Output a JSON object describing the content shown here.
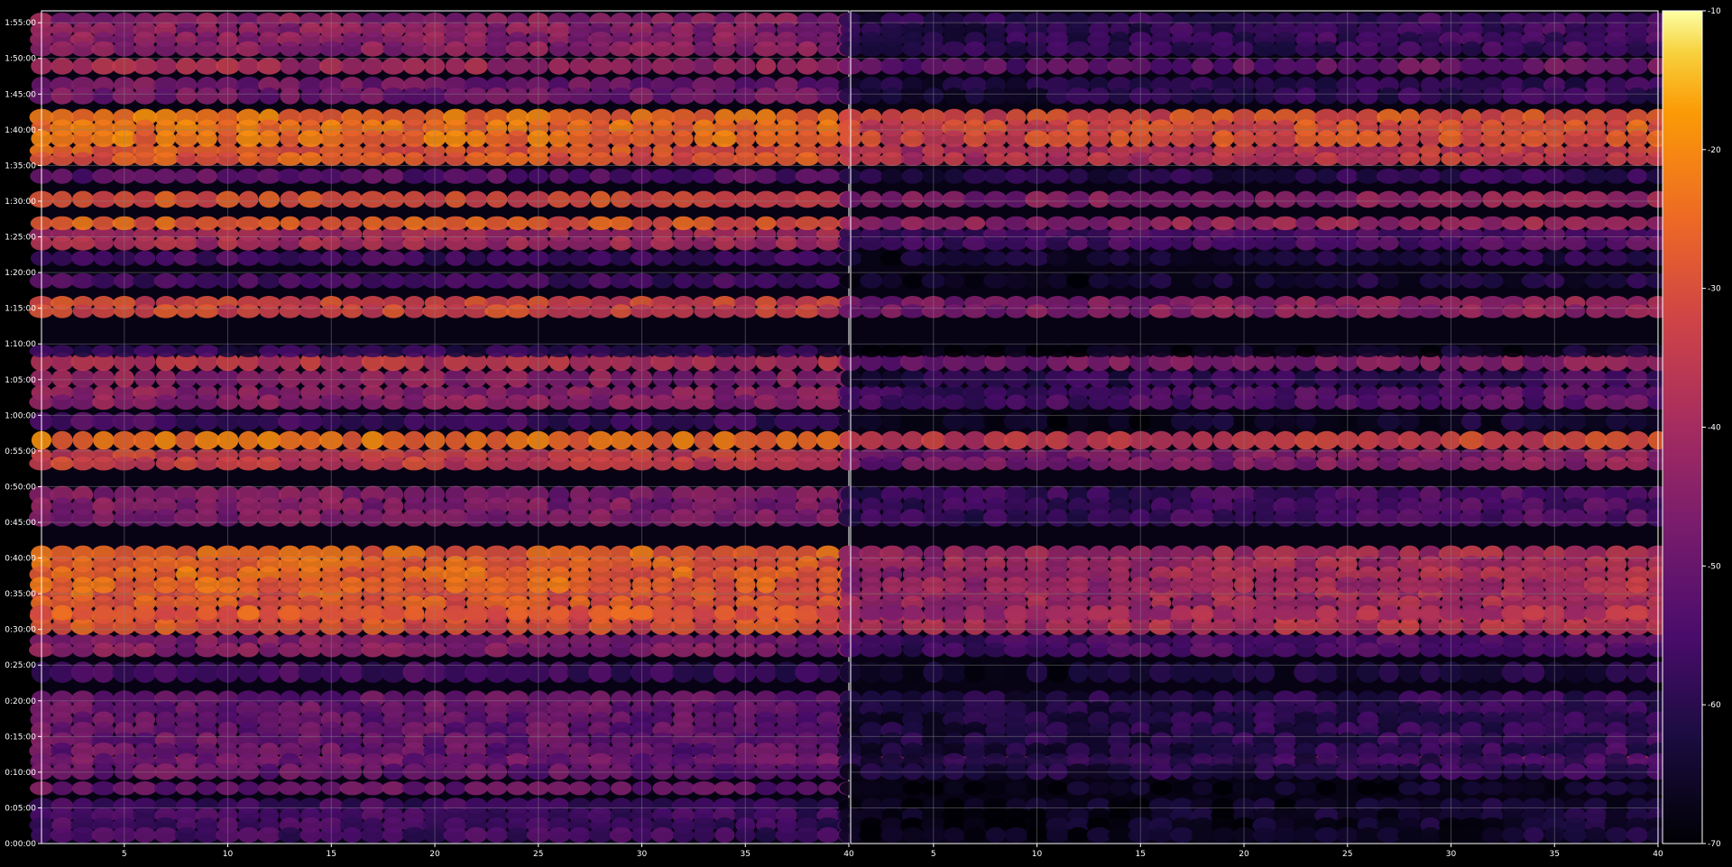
{
  "chart_data": {
    "type": "heatmap",
    "title": "",
    "xlabel": "",
    "ylabel": "",
    "panels": [
      {
        "name": "left",
        "xlim": [
          1,
          40
        ],
        "x_ticks": [
          5,
          10,
          15,
          20,
          25,
          30,
          35,
          40
        ]
      },
      {
        "name": "right",
        "xlim": [
          1,
          40
        ],
        "x_ticks": [
          5,
          10,
          15,
          20,
          25,
          30,
          35,
          40
        ]
      }
    ],
    "y_axis": {
      "unit": "h:mm:ss",
      "ylim_seconds": [
        0,
        7000
      ],
      "tick_labels": [
        "0:00:00",
        "0:05:00",
        "0:10:00",
        "0:15:00",
        "0:20:00",
        "0:25:00",
        "0:30:00",
        "0:35:00",
        "0:40:00",
        "0:45:00",
        "0:50:00",
        "0:55:00",
        "1:00:00",
        "1:05:00",
        "1:10:00",
        "1:15:00",
        "1:20:00",
        "1:25:00",
        "1:30:00",
        "1:35:00",
        "1:40:00",
        "1:45:00",
        "1:50:00",
        "1:55:00"
      ]
    },
    "colorbar": {
      "range": [
        -70,
        -10
      ],
      "tick_labels": [
        "-10",
        "-20",
        "-30",
        "-40",
        "-50",
        "-60",
        "-70"
      ],
      "colormap": "inferno"
    },
    "grid": true,
    "bands": [
      {
        "start_s": 30,
        "end_s": 360,
        "left": -56,
        "right": -66
      },
      {
        "start_s": 690,
        "end_s": 730,
        "left": -36,
        "right": -44
      },
      {
        "start_s": 430,
        "end_s": 500,
        "left": -50,
        "right": -66
      },
      {
        "start_s": 560,
        "end_s": 1260,
        "left": -50,
        "right": -60
      },
      {
        "start_s": 1380,
        "end_s": 1500,
        "left": -56,
        "right": -64
      },
      {
        "start_s": 1590,
        "end_s": 1740,
        "left": -46,
        "right": -54
      },
      {
        "start_s": 1780,
        "end_s": 1960,
        "left": -30,
        "right": -38
      },
      {
        "start_s": 1900,
        "end_s": 2140,
        "left": -28,
        "right": -40
      },
      {
        "start_s": 2130,
        "end_s": 2480,
        "left": -26,
        "right": -40
      },
      {
        "start_s": 2690,
        "end_s": 2980,
        "left": -46,
        "right": -56
      },
      {
        "start_s": 3160,
        "end_s": 3300,
        "left": -34,
        "right": -46
      },
      {
        "start_s": 3340,
        "end_s": 3440,
        "left": -24,
        "right": -34
      },
      {
        "start_s": 3500,
        "end_s": 3600,
        "left": -56,
        "right": -66
      },
      {
        "start_s": 3670,
        "end_s": 3830,
        "left": -44,
        "right": -54
      },
      {
        "start_s": 3860,
        "end_s": 3960,
        "left": -44,
        "right": -58
      },
      {
        "start_s": 4000,
        "end_s": 4100,
        "left": -36,
        "right": -46
      },
      {
        "start_s": 4110,
        "end_s": 4170,
        "left": -60,
        "right": -68
      },
      {
        "start_s": 4440,
        "end_s": 4580,
        "left": -32,
        "right": -44
      },
      {
        "start_s": 4690,
        "end_s": 4770,
        "left": -56,
        "right": -64
      },
      {
        "start_s": 4880,
        "end_s": 4960,
        "left": -56,
        "right": -62
      },
      {
        "start_s": 5010,
        "end_s": 5160,
        "left": -40,
        "right": -54
      },
      {
        "start_s": 5180,
        "end_s": 5250,
        "left": -28,
        "right": -42
      },
      {
        "start_s": 5370,
        "end_s": 5460,
        "left": -30,
        "right": -44
      },
      {
        "start_s": 5570,
        "end_s": 5650,
        "left": -52,
        "right": -60
      },
      {
        "start_s": 5720,
        "end_s": 5860,
        "left": -28,
        "right": -36
      },
      {
        "start_s": 5880,
        "end_s": 6150,
        "left": -24,
        "right": -30
      },
      {
        "start_s": 6240,
        "end_s": 6420,
        "left": -48,
        "right": -60
      },
      {
        "start_s": 6490,
        "end_s": 6580,
        "left": -40,
        "right": -50
      },
      {
        "start_s": 6640,
        "end_s": 6960,
        "left": -44,
        "right": -58
      }
    ],
    "background_level": -68
  }
}
